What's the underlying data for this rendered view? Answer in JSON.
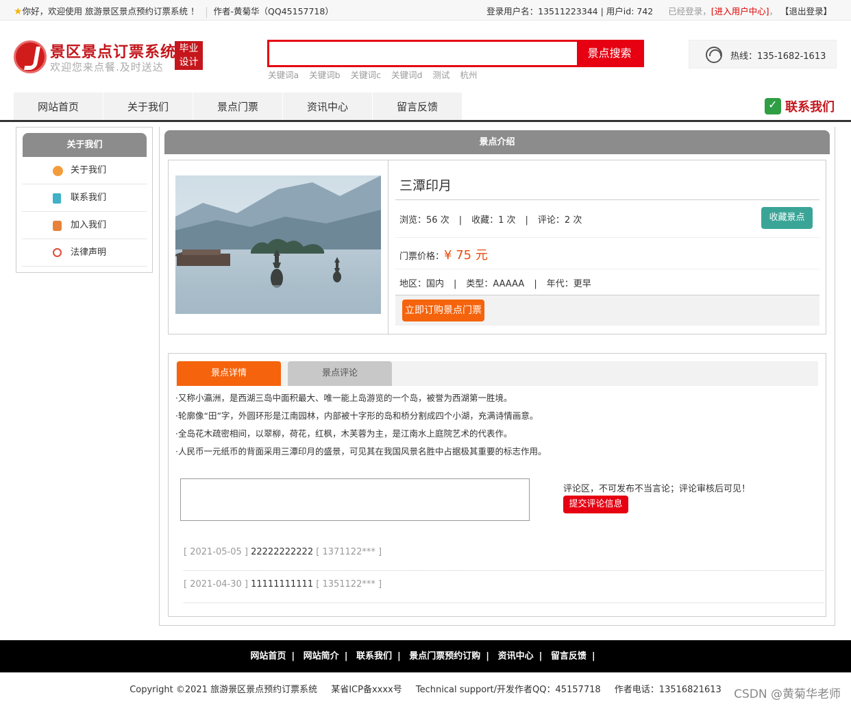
{
  "topbar": {
    "welcome": "你好，欢迎使用 旅游景区景点预约订票系统 ！",
    "author": "作者-黄菊华（QQ45157718）",
    "login_user": "登录用户名：13511223344 | 用户id: 742",
    "logged_in": "已经登录，",
    "user_center": "[进入用户中心]",
    "logout": "【退出登录】"
  },
  "header": {
    "site_name": "景区景点订票系统",
    "slogan": "欢迎您来点餐.及时送达",
    "badge_line1": "毕业",
    "badge_line2": "设计",
    "search_placeholder": "",
    "search_button": "景点搜索",
    "hotwords": [
      "关键词a",
      "关键词b",
      "关键词c",
      "关键词d",
      "测试",
      "杭州"
    ],
    "hotline": "热线：135-1682-1613"
  },
  "nav": {
    "items": [
      "网站首页",
      "关于我们",
      "景点门票",
      "资讯中心",
      "留言反馈"
    ],
    "contact": "联系我们"
  },
  "sidebar": {
    "title": "关于我们",
    "items": [
      {
        "label": "关于我们",
        "icon": "about-icon",
        "color": "#f39c3c"
      },
      {
        "label": "联系我们",
        "icon": "document-icon",
        "color": "#3fb1c8"
      },
      {
        "label": "加入我们",
        "icon": "lock-icon",
        "color": "#e6823a"
      },
      {
        "label": "法律声明",
        "icon": "power-icon",
        "color": "#e04a3a"
      }
    ]
  },
  "main": {
    "section_title": "景点介绍",
    "spot": {
      "title": "三潭印月",
      "views_label": "浏览：",
      "views": "56 次",
      "favs_label": "收藏：",
      "favs": "1 次",
      "comments_label": "评论：",
      "comments": "2 次",
      "fav_button": "收藏景点",
      "price_label": "门票价格：",
      "price": "¥ 75 元",
      "region": "地区：国内",
      "type": "类型：AAAAA",
      "era": "年代：更早",
      "buy_button": "立即订购景点门票"
    },
    "tabs": [
      "景点详情",
      "景点评论"
    ],
    "description": [
      "·又称小瀛洲，是西湖三岛中面积最大、唯一能上岛游览的一个岛，被誉为西湖第一胜境。",
      "·轮廓像“田”字，外圆环形是江南园林，内部被十字形的岛和桥分割成四个小湖，充满诗情画意。",
      "·全岛花木疏密相间，以翠柳，荷花，红枫，木芙蓉为主，是江南水上庭院艺术的代表作。",
      "·人民币一元纸币的背面采用三潭印月的盛景，可见其在我国风景名胜中占据极其重要的标志作用。"
    ],
    "comment_note": "评论区，不可发布不当言论；评论审核后可见！",
    "comment_button": "提交评论信息",
    "comments_list": [
      {
        "date": "[ 2021-05-05 ]",
        "text": "22222222222",
        "user": "[ 1371122*** ]"
      },
      {
        "date": "[ 2021-04-30 ]",
        "text": "11111111111",
        "user": "[ 1351122*** ]"
      }
    ]
  },
  "footer": {
    "links": [
      "网站首页",
      "网站简介",
      "联系我们",
      "景点门票预约订购",
      "资讯中心",
      "留言反馈"
    ],
    "copyright": "Copyright ©2021 旅游景区景点预约订票系统",
    "icp": "某省ICP备xxxx号",
    "support": "Technical support/开发作者QQ：45157718",
    "phone": "作者电话：13516821613",
    "watermark": "CSDN @黄菊华老师"
  },
  "colors": {
    "accent_red": "#e60012",
    "orange": "#f5630c",
    "teal": "#3aa597",
    "header_grey": "#8c8c8c"
  }
}
